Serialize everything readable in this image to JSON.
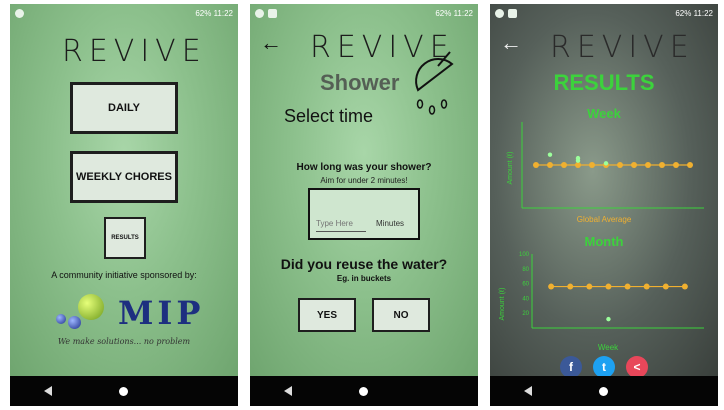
{
  "status_bar": {
    "battery": "62%",
    "time": "11:22"
  },
  "app": {
    "logo": "REVIVE"
  },
  "screen1": {
    "daily_label": "DAILY",
    "weekly_label": "WEEKLY CHORES",
    "results_label": "RESULTS",
    "community_text": "A community initiative sponsored by:",
    "sponsor_name": "MIP",
    "slogan": "We make solutions... no problem"
  },
  "screen2": {
    "title": "Shower",
    "select_time": "Select time",
    "question1": "How long was your shower?",
    "hint": "Aim for under 2 minutes!",
    "time_placeholder": "Type Here",
    "unit": "Minutes",
    "question2": "Did you reuse the water?",
    "question2_sub": "Eg. in buckets",
    "yes_label": "YES",
    "no_label": "NO"
  },
  "screen3": {
    "title": "RESULTS",
    "week_chart_title": "Week",
    "month_chart_title": "Month",
    "global_average_label": "Global Average",
    "ylabel": "Amount (ℓ)",
    "xlabel": "Week",
    "social": [
      "facebook",
      "twitter",
      "share"
    ]
  },
  "colors": {
    "accent_green": "#3cd23c",
    "average_line": "#f0b030",
    "text_dark": "#111111"
  },
  "chart_data": [
    {
      "type": "scatter",
      "title": "Week",
      "xlabel": "",
      "ylabel": "Amount (ℓ)",
      "series": [
        {
          "name": "Global Average",
          "x": [
            1,
            2,
            3,
            4,
            5,
            6,
            7,
            8,
            9,
            10,
            11,
            12
          ],
          "y": [
            50,
            50,
            50,
            50,
            50,
            50,
            50,
            50,
            50,
            50,
            50,
            50
          ]
        }
      ],
      "user_points": {
        "x": [
          2,
          4,
          4,
          6
        ],
        "y": [
          62,
          58,
          55,
          52
        ]
      },
      "ylim": [
        0,
        100
      ]
    },
    {
      "type": "scatter",
      "title": "Month",
      "xlabel": "Week",
      "ylabel": "Amount (ℓ)",
      "yticks": [
        "100",
        "80",
        "60",
        "40",
        "20"
      ],
      "series": [
        {
          "name": "Global Average",
          "x": [
            1,
            2,
            3,
            4,
            5,
            6,
            7,
            8
          ],
          "y": [
            56,
            56,
            56,
            56,
            56,
            56,
            56,
            56
          ]
        }
      ],
      "user_points": {
        "x": [
          4
        ],
        "y": [
          12
        ]
      },
      "ylim": [
        0,
        100
      ]
    }
  ]
}
